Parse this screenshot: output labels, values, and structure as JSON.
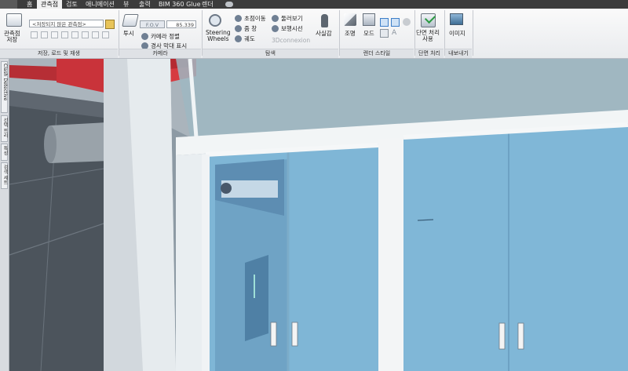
{
  "tabs": [
    "홈",
    "관측점",
    "검토",
    "애니메이션",
    "뷰",
    "출력",
    "BIM 360 Glue",
    "렌더"
  ],
  "active_tab": "관측점",
  "ribbon": {
    "save_load_playback": {
      "save_viewpoint": "관측점\n저장",
      "viewpoint_combo": "<저장되지 않은 관측점>",
      "title": "저장, 로드 및 재생"
    },
    "camera": {
      "perspective": "투시",
      "fov_label": "F.O.V",
      "fov_value": "85.339",
      "align_camera": "카메라 정렬",
      "show_tilt_bar": "경사 막대 표시",
      "title": "카메라"
    },
    "navigate": {
      "steering_wheels": "Steering\nWheels",
      "pan": "초점이동",
      "zoom": "줌 창",
      "orbit": "궤도",
      "look_around": "둘러보기",
      "walk": "보행시선",
      "connexion": "3Dconnexion",
      "realism": "사실감",
      "title": "탐색"
    },
    "render_style": {
      "lighting": "조명",
      "mode": "모드",
      "title": "렌더 스타일"
    },
    "sectioning": {
      "enable": "단면 처리\n사용",
      "title": "단면 처리"
    },
    "export": {
      "image": "이미지",
      "title": "내보내기"
    }
  },
  "dock_tabs": [
    "Clash Detective",
    "선택 트리",
    "특성",
    "검색 세트"
  ],
  "colors": {
    "tab_bar": "#3c3c3c",
    "ribbon_bg": "#eef0f2",
    "accent_blue": "#3d7ec8",
    "glass": "#7fb6d6",
    "frame_white": "#f3f5f6",
    "duct_red": "#c9333a"
  }
}
